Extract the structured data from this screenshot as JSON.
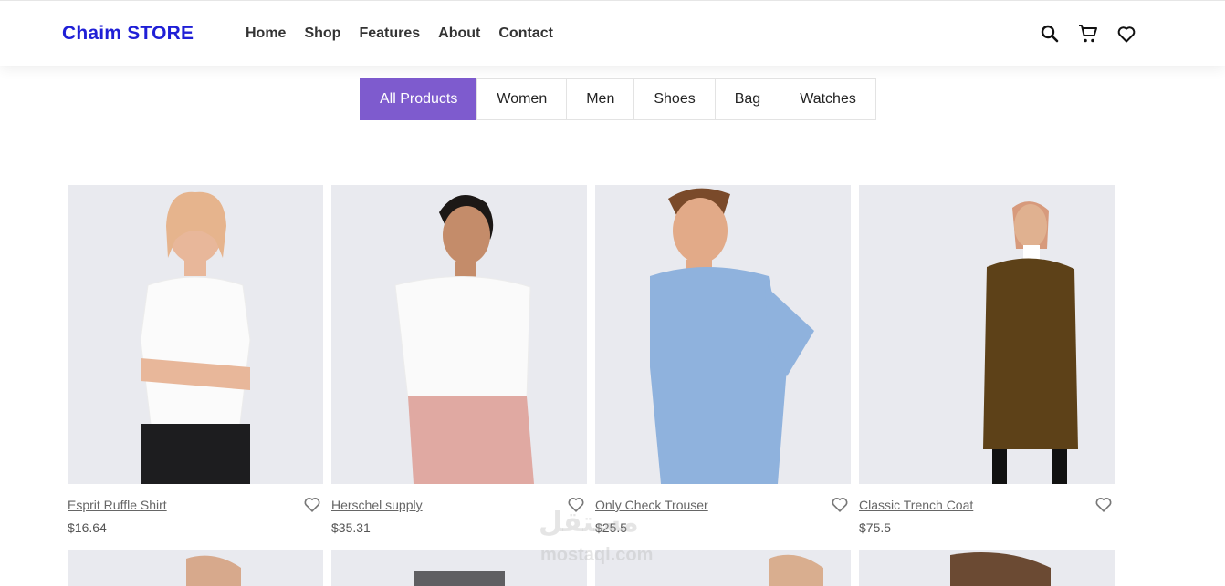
{
  "brand": {
    "name": "Chaim STORE",
    "color": "#1f1fd6"
  },
  "nav": {
    "items": [
      "Home",
      "Shop",
      "Features",
      "About",
      "Contact"
    ]
  },
  "header_icons": [
    "search-icon",
    "cart-icon",
    "heart-icon"
  ],
  "filters": {
    "active_color": "#7e5bce",
    "items": [
      "All Products",
      "Women",
      "Men",
      "Shoes",
      "Bag",
      "Watches"
    ],
    "active": "All Products"
  },
  "products": [
    {
      "name": "Esprit Ruffle Shirt",
      "price": "$16.64"
    },
    {
      "name": "Herschel supply",
      "price": "$35.31"
    },
    {
      "name": "Only Check Trouser",
      "price": "$25.5"
    },
    {
      "name": "Classic Trench Coat",
      "price": "$75.5"
    }
  ],
  "watermark": {
    "text": "مستقل",
    "subtext": "mostaql.com"
  }
}
